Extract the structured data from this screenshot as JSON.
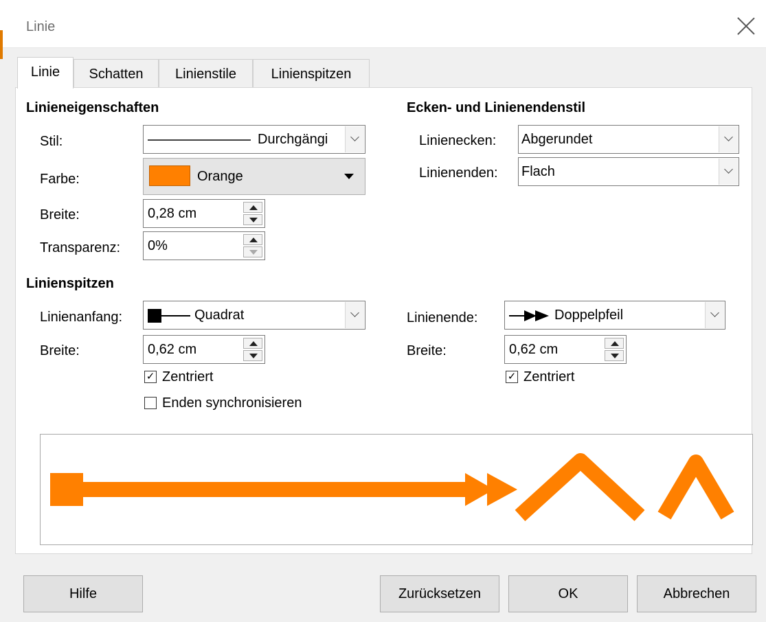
{
  "window": {
    "title": "Linie"
  },
  "tabs": [
    {
      "label": "Linie"
    },
    {
      "label": "Schatten"
    },
    {
      "label": "Linienstile"
    },
    {
      "label": "Linienspitzen"
    }
  ],
  "props": {
    "heading": "Linieneigenschaften",
    "style_label": "Stil:",
    "style_value": "Durchgängi",
    "color_label": "Farbe:",
    "color_value": "Orange",
    "color_swatch": "#ff8000",
    "width_label": "Breite:",
    "width_value": "0,28 cm",
    "transparency_label": "Transparenz:",
    "transparency_value": "0%"
  },
  "corners": {
    "heading": "Ecken- und Linienendenstil",
    "corner_label": "Linienecken:",
    "corner_value": "Abgerundet",
    "cap_label": "Linienenden:",
    "cap_value": "Flach"
  },
  "arrows": {
    "heading": "Linienspitzen",
    "start_label": "Linienanfang:",
    "start_value": "Quadrat",
    "start_width_label": "Breite:",
    "start_width_value": "0,62 cm",
    "start_centered": "Zentriert",
    "sync_ends": "Enden synchronisieren",
    "end_label": "Linienende:",
    "end_value": "Doppelpfeil",
    "end_width_label": "Breite:",
    "end_width_value": "0,62 cm",
    "end_centered": "Zentriert"
  },
  "buttons": {
    "help": "Hilfe",
    "reset": "Zurücksetzen",
    "ok": "OK",
    "cancel": "Abbrechen"
  }
}
